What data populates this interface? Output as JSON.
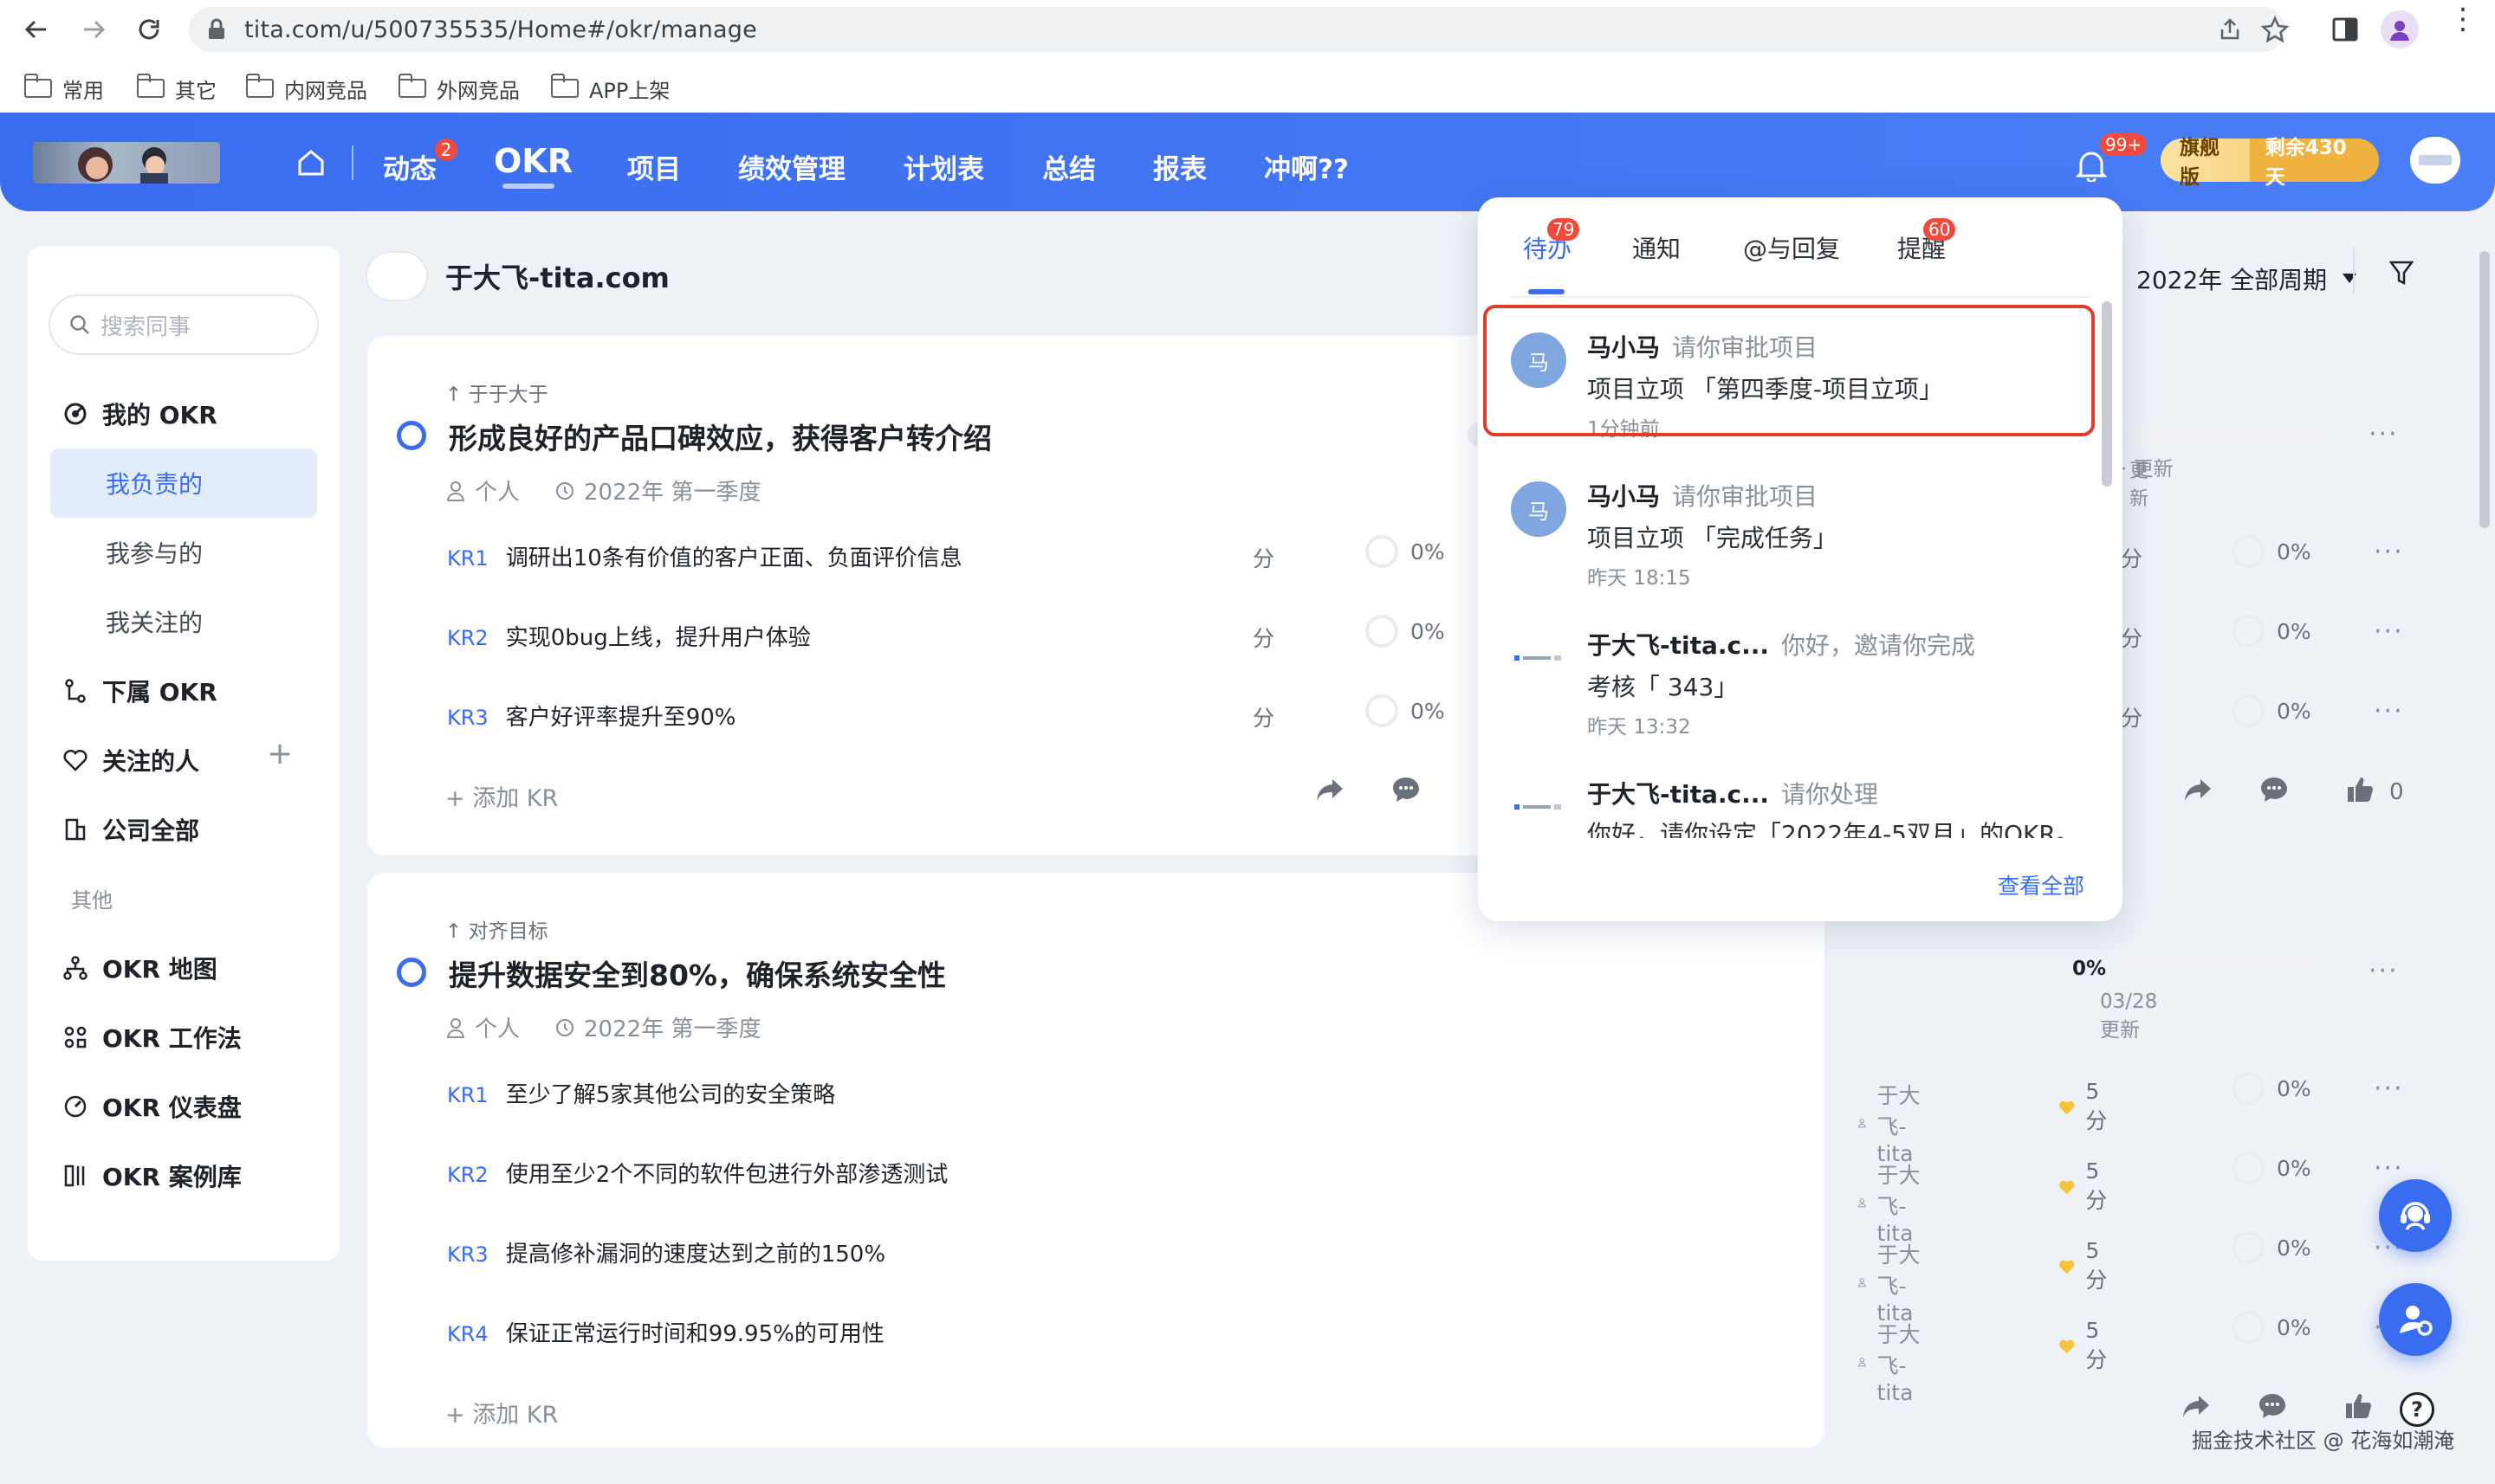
{
  "browser": {
    "url": "tita.com/u/500735535/Home#/okr/manage",
    "bookmarks": [
      "常用",
      "其它",
      "内网竞品",
      "外网竞品",
      "APP上架"
    ]
  },
  "header": {
    "nav": [
      "动态",
      "OKR",
      "项目",
      "绩效管理",
      "计划表",
      "总结",
      "报表",
      "冲啊??"
    ],
    "dynamic_badge": "2",
    "bell_badge": "99+",
    "plan_label": "旗舰版",
    "plan_remaining": "剩余430天",
    "accent": "#3a6cf0"
  },
  "sidebar": {
    "search_placeholder": "搜索同事",
    "my_okr": "我的 OKR",
    "sub_items": [
      "我负责的",
      "我参与的",
      "我关注的"
    ],
    "sub_okr": "下属 OKR",
    "followed": "关注的人",
    "company": "公司全部",
    "other_heading": "其他",
    "other_items": [
      "OKR 地图",
      "OKR 工作法",
      "OKR 仪表盘",
      "OKR 案例库"
    ]
  },
  "main": {
    "owner_name": "于大飞-tita.com",
    "period": "2022年 全部周期",
    "objectives": [
      {
        "tag": "于于大于",
        "title": "形成良好的产品口碑效应，获得客户转介绍",
        "type": "个人",
        "period": "2022年 第一季度",
        "progress_note": "更新",
        "krs": [
          {
            "key": "KR1",
            "text": "调研出10条有价值的客户正面、负面评价信息",
            "score": "分",
            "pct": "0%"
          },
          {
            "key": "KR2",
            "text": "实现0bug上线，提升用户体验",
            "score": "分",
            "pct": "0%"
          },
          {
            "key": "KR3",
            "text": "客户好评率提升至90%",
            "score": "分",
            "pct": "0%"
          }
        ],
        "add_kr": "添加 KR",
        "likes": "0"
      },
      {
        "tag": "对齐目标",
        "title": "提升数据安全到80%，确保系统安全性",
        "type": "个人",
        "period": "2022年 第一季度",
        "progress": "0%",
        "progress_note": "03/28 更新",
        "krs": [
          {
            "key": "KR1",
            "text": "至少了解5家其他公司的安全策略",
            "owner": "于大飞-tita",
            "score": "5 分",
            "pct": "0%"
          },
          {
            "key": "KR2",
            "text": "使用至少2个不同的软件包进行外部渗透测试",
            "owner": "于大飞-tita",
            "score": "5 分",
            "pct": "0%"
          },
          {
            "key": "KR3",
            "text": "提高修补漏洞的速度达到之前的150%",
            "owner": "于大飞-tita",
            "score": "5 分",
            "pct": "0%"
          },
          {
            "key": "KR4",
            "text": "保证正常运行时间和99.95%的可用性",
            "owner": "于大飞-tita",
            "score": "5 分",
            "pct": "0%"
          }
        ],
        "add_kr": "添加 KR"
      }
    ]
  },
  "popup": {
    "tabs": [
      "待办",
      "通知",
      "@与回复",
      "提醒"
    ],
    "tab_badges": {
      "todo": "79",
      "remind": "60"
    },
    "items": [
      {
        "avatar": "马",
        "name": "马小马",
        "action": "请你审批项目",
        "body": "项目立项 「第四季度-项目立项」",
        "time": "1分钟前"
      },
      {
        "avatar": "马",
        "name": "马小马",
        "action": "请你审批项目",
        "body": "项目立项 「完成任务」",
        "time": "昨天 18:15"
      },
      {
        "avatar": "",
        "name": "于大飞-tita.c...",
        "action": "你好，邀请你完成",
        "body": "考核「 343」",
        "time": "昨天 13:32"
      },
      {
        "avatar": "",
        "name": "于大飞-tita.c...",
        "action": "请你处理",
        "body": "你好，请你设定「2022年4-5双月」的OKR。",
        "time": ""
      }
    ],
    "view_all": "查看全部"
  },
  "watermark": "掘金技术社区 @ 花海如潮淹"
}
